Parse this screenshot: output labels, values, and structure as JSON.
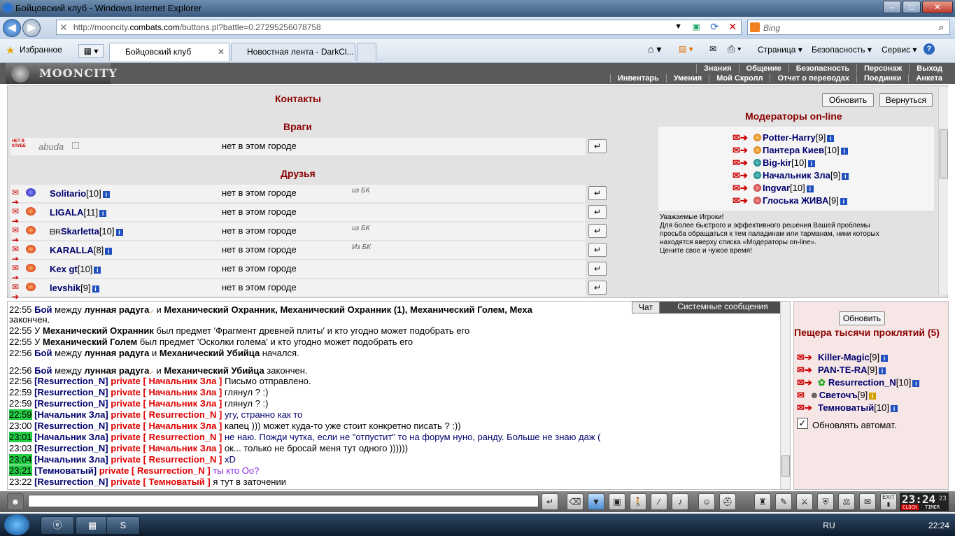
{
  "window": {
    "title": "Бойцовский клуб - Windows Internet Explorer",
    "minimize": "–",
    "maximize": "□",
    "close": "✕"
  },
  "address": {
    "url_prefix": "http://mooncity.",
    "url_domain": "combats.com",
    "url_suffix": "/buttons.pl?battle=0.27295256078758",
    "search_placeholder": "Bing"
  },
  "favbar": {
    "favorites": "Избранное",
    "tabs": [
      "Бойцовский клуб",
      "Новостная лента - DarkCl..."
    ],
    "commands": [
      "Страница",
      "Безопасность",
      "Сервис"
    ]
  },
  "game": {
    "logo": "MOONCITY",
    "menu_top": [
      "Знания",
      "Общение",
      "Безопасность",
      "Персонаж",
      "Выход"
    ],
    "menu_bottom": [
      "Инвентарь",
      "Умения",
      "Мой Скролл",
      "Отчет о переводах",
      "Поединки",
      "Анкета"
    ]
  },
  "contacts": {
    "title": "Контакты",
    "refresh_btn": "Обновить",
    "back_btn": "Вернуться",
    "enemies_title": "Враги",
    "enemies": [
      {
        "name": "abuda",
        "status": "нет в этом городе",
        "badge": "НЕТ В КЛУБЕ"
      }
    ],
    "friends_title": "Друзья",
    "friends": [
      {
        "name": "Solitario",
        "level": "[10]",
        "status": "нет в этом городе",
        "note": "из БК"
      },
      {
        "name": "LIGALA",
        "level": "[11]",
        "status": "нет в этом городе",
        "note": ""
      },
      {
        "name": "Skarletta",
        "level": "[10]",
        "status": "нет в этом городе",
        "note": "из БК"
      },
      {
        "name": "KARALLA",
        "level": "[8]",
        "status": "нет в этом городе",
        "note": "Из БК"
      },
      {
        "name": "Kex gt",
        "level": "[10]",
        "status": "нет в этом городе",
        "note": ""
      },
      {
        "name": "levshik",
        "level": "[9]",
        "status": "нет в этом городе",
        "note": ""
      }
    ]
  },
  "moderators": {
    "title": "Модераторы on-line",
    "list": [
      {
        "name": "Potter-Harry",
        "level": "[9]"
      },
      {
        "name": "Пантера Киев",
        "level": "[10]"
      },
      {
        "name": "Big-kir",
        "level": "[10]"
      },
      {
        "name": "Начальник Зла",
        "level": "[9]"
      },
      {
        "name": "Ingvar",
        "level": "[10]"
      },
      {
        "name": "Глоська ЖИВА",
        "level": "[9]"
      }
    ],
    "note_lines": [
      "Уважаемые Игроки!",
      "Для более быстрого и эффективного решения Вашей проблемы",
      "просьба обращаться к тем паладинам или тарманам, ники которых",
      "находятся вверху списка «Модераторы on-line».",
      "Цените свое и чужое время!"
    ]
  },
  "chat": {
    "tabs": {
      "chat": "Чат",
      "system": "Системные сообщения"
    },
    "lines": [
      {
        "time": "22:55",
        "prefix": "Бой",
        "text1": " между ",
        "b1": "лунная радуга",
        "text2": " и ",
        "b2": "Механический Охранник, Механический Охранник (1), Механический Голем, Меха"
      },
      {
        "time": "",
        "prefix": "",
        "text1": "закончен.",
        "b1": "",
        "text2": "",
        "b2": ""
      },
      {
        "time": "22:55",
        "prefix": "",
        "text1": "У ",
        "b1": "Механический Охранник",
        "text2": " был предмет 'Фрагмент древней плиты' и кто угодно может подобрать его",
        "b2": ""
      },
      {
        "time": "22:55",
        "prefix": "",
        "text1": "У ",
        "b1": "Механический Голем",
        "text2": " был предмет 'Осколки голема' и кто угодно может подобрать его",
        "b2": ""
      },
      {
        "time": "22:56",
        "prefix": "Бой",
        "text1": " между ",
        "b1": "лунная радуга",
        "text2": " и ",
        "b2": "Механический Убийца",
        "tail": " начался."
      },
      {
        "time": "22:56",
        "prefix": "Бой",
        "text1": " между ",
        "b1": "лунная радуга",
        "text2": " и ",
        "b2": "Механический Убийца",
        "tail": " закончен."
      }
    ],
    "private": [
      {
        "time": "22:56",
        "green": false,
        "from": "[Resurrection_N]",
        "priv": "private",
        "to": "[ Начальник Зла ]",
        "msg": "Письмо отправлено.",
        "blue": false
      },
      {
        "time": "22:59",
        "green": false,
        "from": "[Resurrection_N]",
        "priv": "private",
        "to": "[ Начальник Зла ]",
        "msg": "глянул ? :)",
        "blue": false
      },
      {
        "time": "22:59",
        "green": false,
        "from": "[Resurrection_N]",
        "priv": "private",
        "to": "[ Начальник Зла ]",
        "msg": "глянул ? :)",
        "blue": false
      },
      {
        "time": "22:59",
        "green": true,
        "from": "[Начальник Зла]",
        "priv": "private",
        "to": "[ Resurrection_N ]",
        "msg": "угу, странно как то",
        "blue": true
      },
      {
        "time": "23:00",
        "green": false,
        "from": "[Resurrection_N]",
        "priv": "private",
        "to": "[ Начальник Зла ]",
        "msg": "капец ))) может куда-то уже стоит конкретно писать ? :))",
        "blue": false
      },
      {
        "time": "23:01",
        "green": true,
        "from": "[Начальник Зла]",
        "priv": "private",
        "to": "[ Resurrection_N ]",
        "msg": "не наю. Пожди чутка, если не \"отпустит\" то на форум нуно, ранду. Больше не знаю даж (",
        "blue": true
      },
      {
        "time": "23:03",
        "green": false,
        "from": "[Resurrection_N]",
        "priv": "private",
        "to": "[ Начальник Зла ]",
        "msg": "ок... только не бросай меня тут одного ))))))",
        "blue": false
      },
      {
        "time": "23:04",
        "green": true,
        "from": "[Начальник Зла]",
        "priv": "private",
        "to": "[ Resurrection_N ]",
        "msg": "xD",
        "blue": true
      },
      {
        "time": "23:21",
        "green": true,
        "from": "[Темноватый]",
        "priv": "private",
        "to": "[ Resurrection_N ]",
        "msg": "ты кто Оо?",
        "blue": true
      },
      {
        "time": "23:22",
        "green": false,
        "from": "[Resurrection_N]",
        "priv": "private",
        "to": "[ Темноватый ]",
        "msg": "я тут в заточении",
        "blue": false
      }
    ]
  },
  "location": {
    "refresh_btn": "Обновить",
    "title": "Пещера тысячи проклятий (5)",
    "players": [
      {
        "name": "Killer-Magic",
        "level": "[9]"
      },
      {
        "name": "PAN-TE-RA",
        "level": "[9]"
      },
      {
        "name": "Resurrection_N",
        "level": "[10]"
      },
      {
        "name": "Светочъ",
        "level": "[9]"
      },
      {
        "name": "Темноватый",
        "level": "[10]"
      }
    ],
    "auto_refresh": "Обновлять автомат."
  },
  "clock": {
    "time": "23:24",
    "seconds": "23",
    "label1": "CLOCK",
    "label2": "TIMER",
    "exit": "EXIT"
  },
  "taskbar": {
    "lang": "RU",
    "time": "22:24"
  }
}
